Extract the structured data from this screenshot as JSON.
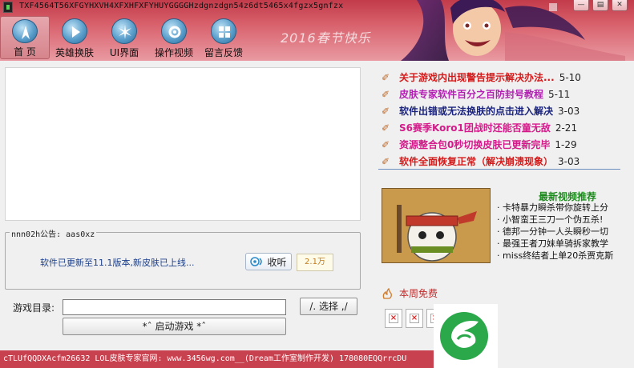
{
  "window": {
    "title": "TXF4564T56XFGYHXVH4XFXHFXFYHUYGGGGHzdgnzdgn54z6dt5465x4fgzx5gnfzx",
    "controls": {
      "minimize": "—",
      "menu": "▤",
      "close": "✕"
    }
  },
  "nav": {
    "items": [
      {
        "id": "home",
        "label": "首 页",
        "icon": "compass-icon",
        "active": true
      },
      {
        "id": "skins",
        "label": "英雄换肤",
        "icon": "play-icon",
        "active": false
      },
      {
        "id": "ui",
        "label": "UI界面",
        "icon": "burst-icon",
        "active": false
      },
      {
        "id": "video",
        "label": "操作视频",
        "icon": "gear-icon",
        "active": false
      },
      {
        "id": "feedback",
        "label": "留言反馈",
        "icon": "grid-icon",
        "active": false
      }
    ]
  },
  "banner": {
    "festival_text": "2016春节快乐"
  },
  "notice": {
    "legend": "nnn02h公告: aas0xz",
    "text": "软件已更新至11.1版本,新皮肤已上线...",
    "listen_label": "收听",
    "listen_count": "2.1万"
  },
  "game_dir": {
    "label": "游戏目录:",
    "value": "",
    "browse_label": "/. 选择 ,/",
    "launch_label": "*ˆ 启动游戏  *ˆ"
  },
  "news": [
    {
      "title": "关于游戏内出现警告提示解决办法...",
      "date": "5-10",
      "color": "#d41a1a"
    },
    {
      "title": "皮肤专家软件百分之百防封号教程",
      "date": "5-11",
      "color": "#b41fb4"
    },
    {
      "title": "软件出错或无法换肤的点击进入解决",
      "date": "3-03",
      "color": "#1a237e"
    },
    {
      "title": "S6赛季Koro1团战时还能否童无敌",
      "date": "2-21",
      "color": "#d41a8a"
    },
    {
      "title": "资源整合包0秒切换皮肤已更新完毕",
      "date": "1-29",
      "color": "#d41a8a"
    },
    {
      "title": "软件全面恢复正常（解决崩溃现象）",
      "date": "3-03",
      "color": "#d41a1a"
    }
  ],
  "videos": {
    "title": "最新视频推荐",
    "items": [
      "卡特暴力瞬杀带你旋转上分",
      "小智蛮王三刀一个伪五杀!",
      "德邦一分钟一人头瞬秒一切",
      "最强王者刀妹单骑拆家教学",
      "miss终结者上单20杀贾克斯"
    ]
  },
  "weekly_free": {
    "label": "本周免费",
    "slots": 3
  },
  "status_bar": {
    "text": "cTLUfQQDXAcfm26632  LOL皮肤专家官网: www.3456wg.com__(Dream工作室制作开发)  178080EQQrrcDU"
  },
  "colors": {
    "header": "#c23b4a",
    "status_bar": "#c8414e",
    "video_title": "#1d8a1d"
  }
}
